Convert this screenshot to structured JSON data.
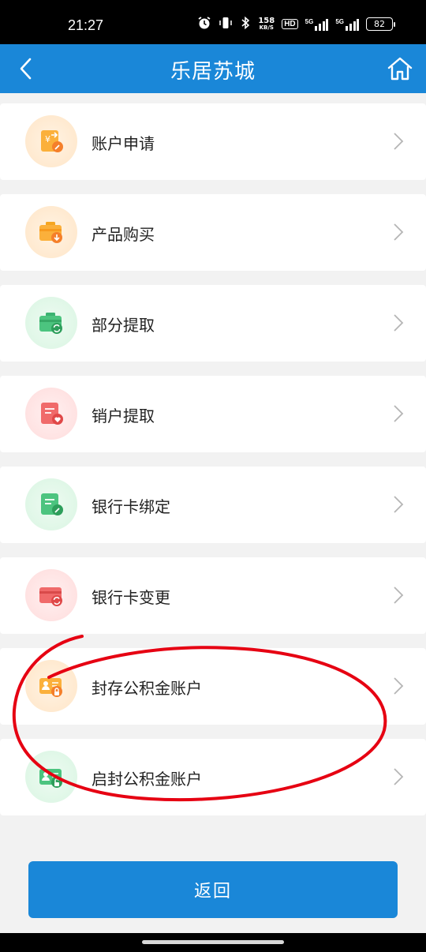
{
  "status_bar": {
    "time": "21:27",
    "speed_value": "158",
    "speed_unit": "KB/S",
    "hd_label": "HD",
    "net1": "5G",
    "net2": "5G",
    "battery": "82"
  },
  "header": {
    "title": "乐居苏城",
    "back_icon": "chevron-left-icon",
    "home_icon": "home-icon"
  },
  "items": [
    {
      "label": "账户申请",
      "icon": "account-apply-icon",
      "tone": "orange"
    },
    {
      "label": "产品购买",
      "icon": "product-purchase-icon",
      "tone": "orange"
    },
    {
      "label": "部分提取",
      "icon": "partial-withdraw-icon",
      "tone": "green"
    },
    {
      "label": "销户提取",
      "icon": "close-account-icon",
      "tone": "red"
    },
    {
      "label": "银行卡绑定",
      "icon": "bind-card-icon",
      "tone": "green"
    },
    {
      "label": "银行卡变更",
      "icon": "change-card-icon",
      "tone": "red"
    },
    {
      "label": "封存公积金账户",
      "icon": "seal-account-icon",
      "tone": "orange"
    },
    {
      "label": "启封公积金账户",
      "icon": "unseal-account-icon",
      "tone": "green"
    }
  ],
  "return_button": "返回",
  "colors": {
    "brand_blue": "#1a87d8",
    "annotation_red": "#e60012"
  }
}
